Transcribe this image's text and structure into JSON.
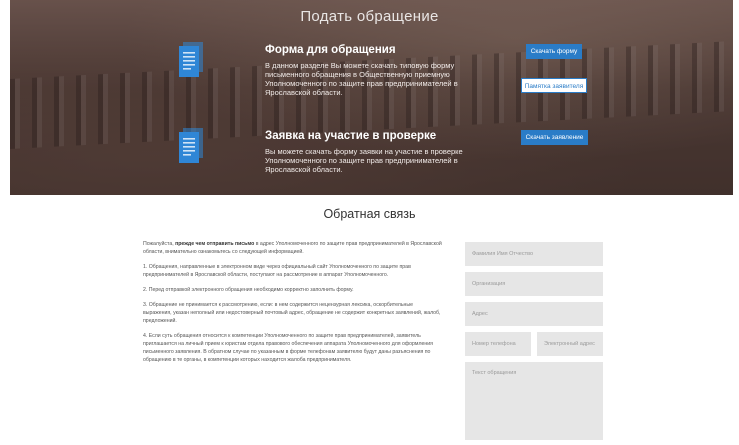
{
  "hero": {
    "title": "Подать обращение",
    "item1": {
      "title": "Форма для обращения",
      "text": "В данном разделе Вы можете скачать типовую форму письменного обращения в Общественную приемную Уполномоченного по защите прав предпринимателей в Ярославской области.",
      "button_primary": "Скачать форму",
      "button_secondary": "Памятка заявителя"
    },
    "item2": {
      "title": "Заявка на участие в проверке",
      "text": "Вы можете скачать форму заявки на участие в проверке Уполномоченного по защите прав предпринимателей в Ярославской области.",
      "button_primary": "Скачать заявление"
    },
    "colors": {
      "button": "#2a7cc7",
      "icon": "#2f86d6"
    }
  },
  "feedback": {
    "title": "Обратная связь",
    "intro_prefix": "Пожалуйста, ",
    "intro_bold": "прежде чем отправить письмо",
    "intro_suffix": " в адрес Уполномоченного по защите прав предпринимателей в Ярославской области, внимательно ознакомьтесь со следующей информацией.",
    "rules": [
      "1. Обращения, направленные в электронном виде через официальный сайт Уполномоченного по защите прав предпринимателей в Ярославской области, поступают на рассмотрение в аппарат Уполномоченного.",
      "2. Перед отправкой электронного обращения необходимо корректно заполнить форму.",
      "3. Обращение не принимается к рассмотрению, если: в нем содержится нецензурная лексика, оскорбительные выражения, указан неполный или недостоверный почтовый адрес, обращение не содержит конкретных заявлений, жалоб, предложений.",
      "4. Если суть обращения относится к компетенции Уполномоченного по защите прав предпринимателей, заявитель приглашается на личный прием к юристам отдела правового обеспечения аппарата Уполномоченного для оформления письменного заявления. В обратном случае по указанным в форме телефонам заявителю будут даны разъяснения по обращению в те органы, в компетенции которых находится жалоба предпринимателя."
    ],
    "form": {
      "name_placeholder": "Фамилия Имя Отчество",
      "org_placeholder": "Организация",
      "address_placeholder": "Адрес",
      "phone_placeholder": "Номер телефона",
      "email_placeholder": "Электронный адрес",
      "message_placeholder": "Текст обращения"
    }
  }
}
